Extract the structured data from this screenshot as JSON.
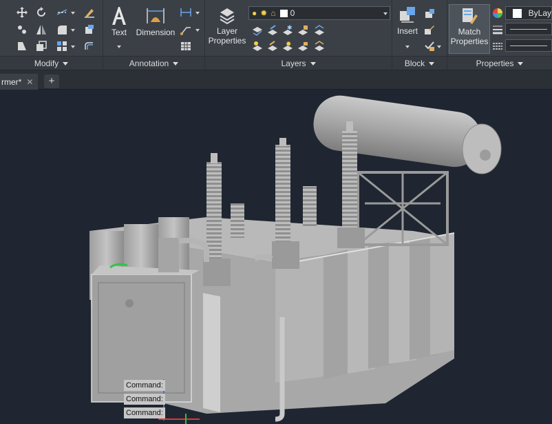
{
  "ribbon": {
    "panels": {
      "modify": "Modify",
      "annotation": "Annotation",
      "layers": "Layers",
      "block": "Block",
      "properties": "Properties"
    },
    "buttons": {
      "text": "Text",
      "dimension": "Dimension",
      "layer_properties_line1": "Layer",
      "layer_properties_line2": "Properties",
      "insert": "Insert",
      "match_properties_line1": "Match",
      "match_properties_line2": "Properties"
    },
    "layer_combo_value": "0",
    "bylayer_value": "ByLay"
  },
  "tabs": {
    "document_tab": "rmer*",
    "close_glyph": "✕",
    "new_tab_glyph": "+"
  },
  "command_lines": [
    "Command:",
    "Command:",
    "Command:"
  ],
  "colors": {
    "ribbon_bg": "#3b4047",
    "viewport_bg": "#1f2631",
    "model_gray": "#a9a9a9"
  }
}
